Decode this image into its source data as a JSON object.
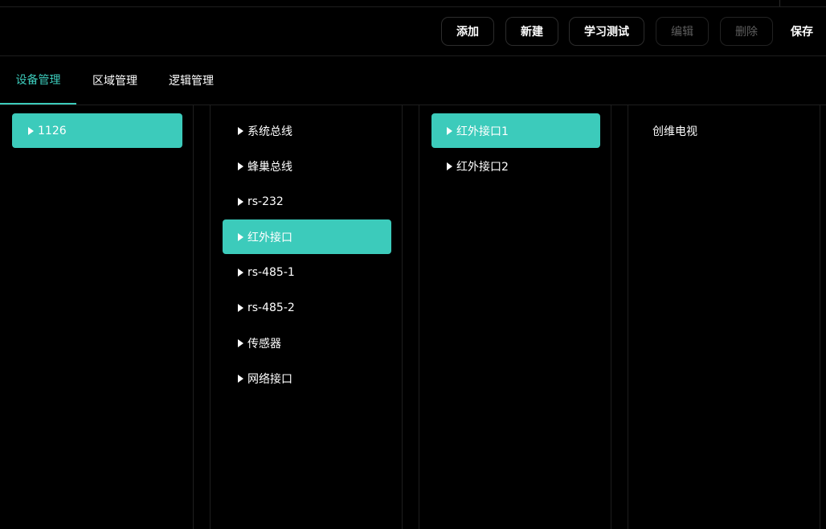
{
  "toolbar": {
    "add_label": "添加",
    "new_label": "新建",
    "learn_test_label": "学习测试",
    "edit_label": "编辑",
    "delete_label": "删除",
    "save_label": "保存"
  },
  "tabs": [
    {
      "label": "设备管理",
      "active": true
    },
    {
      "label": "区域管理",
      "active": false
    },
    {
      "label": "逻辑管理",
      "active": false
    }
  ],
  "columns": {
    "devices": [
      {
        "label": "1126",
        "selected": true
      }
    ],
    "buses": [
      {
        "label": "系统总线",
        "selected": false
      },
      {
        "label": "蜂巢总线",
        "selected": false
      },
      {
        "label": "rs-232",
        "selected": false
      },
      {
        "label": "红外接口",
        "selected": true
      },
      {
        "label": "rs-485-1",
        "selected": false
      },
      {
        "label": "rs-485-2",
        "selected": false
      },
      {
        "label": "传感器",
        "selected": false
      },
      {
        "label": "网络接口",
        "selected": false
      }
    ],
    "interfaces": [
      {
        "label": "红外接口1",
        "selected": true
      },
      {
        "label": "红外接口2",
        "selected": false
      }
    ],
    "targets": [
      {
        "label": "创维电视",
        "selected": false
      }
    ]
  },
  "colors": {
    "accent": "#3ccbbb",
    "background": "#000000",
    "text": "#ffffff",
    "disabled_text": "#5e5e5e"
  },
  "icons": {
    "expand": "caret-right-icon"
  }
}
